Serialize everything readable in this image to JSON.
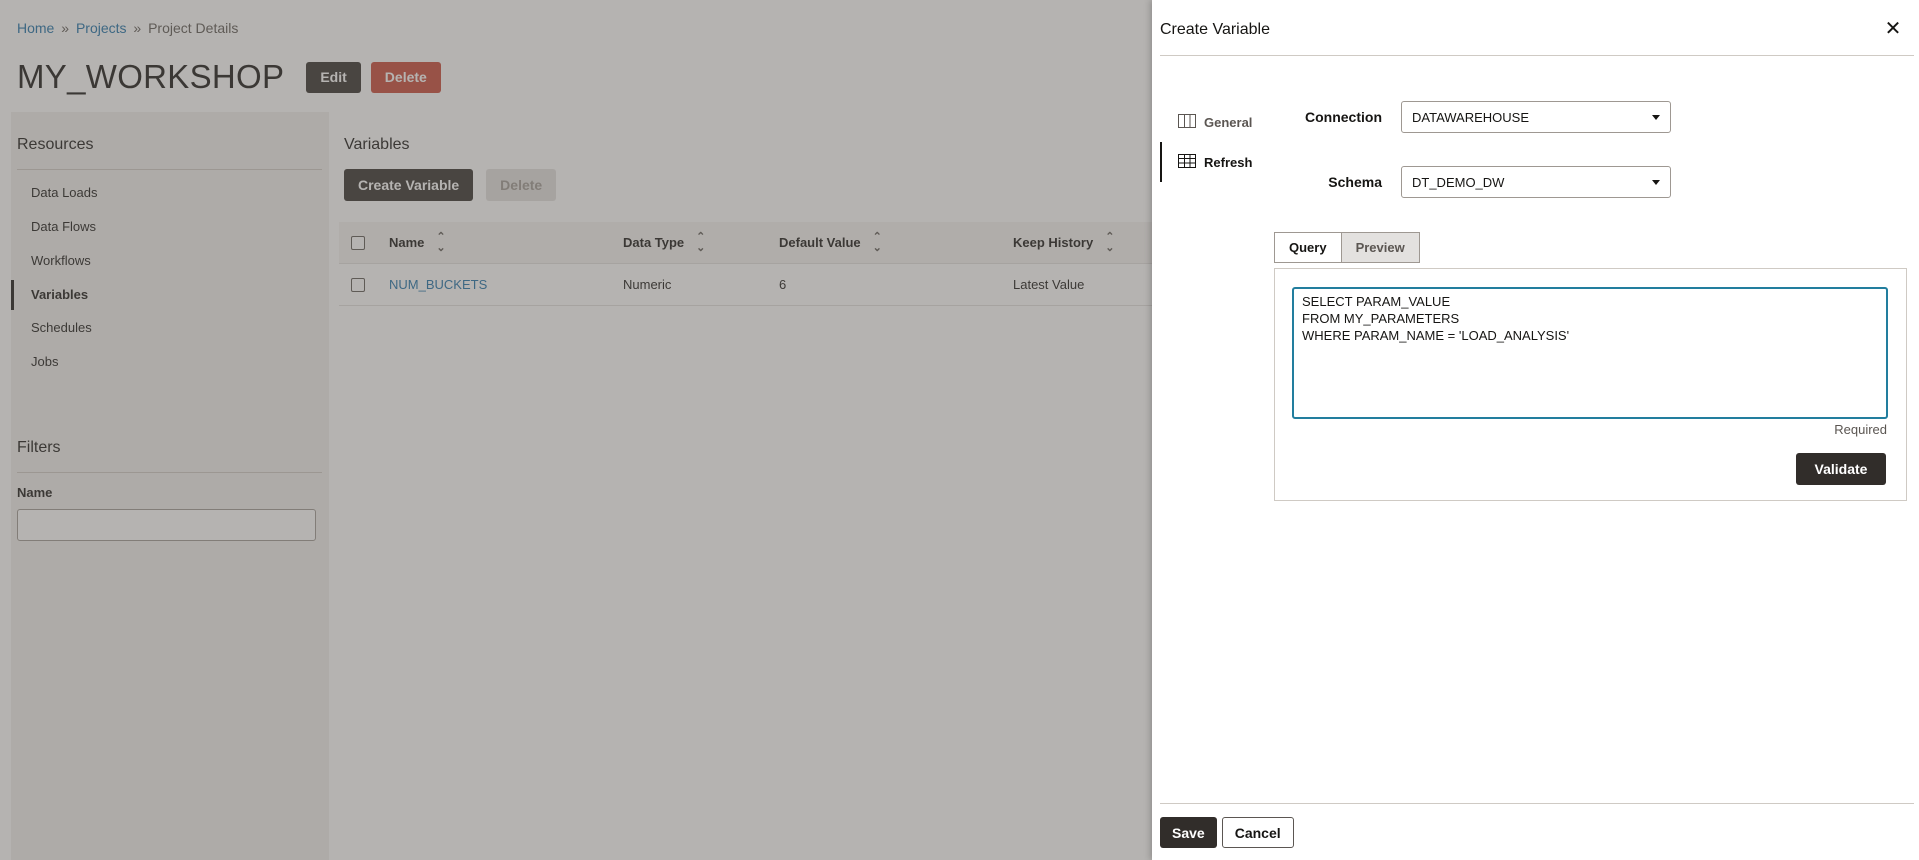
{
  "breadcrumb": {
    "home": "Home",
    "sep": "»",
    "projects": "Projects",
    "current": "Project Details"
  },
  "project": {
    "title": "MY_WORKSHOP",
    "edit_label": "Edit",
    "delete_label": "Delete"
  },
  "sidebar": {
    "resources_heading": "Resources",
    "items": [
      {
        "label": "Data Loads"
      },
      {
        "label": "Data Flows"
      },
      {
        "label": "Workflows"
      },
      {
        "label": "Variables"
      },
      {
        "label": "Schedules"
      },
      {
        "label": "Jobs"
      }
    ],
    "filters_heading": "Filters",
    "name_label": "Name",
    "name_value": ""
  },
  "main": {
    "heading": "Variables",
    "create_label": "Create Variable",
    "delete_label": "Delete",
    "columns": [
      "Name",
      "Data Type",
      "Default Value",
      "Keep History"
    ],
    "rows": [
      {
        "name": "NUM_BUCKETS",
        "data_type": "Numeric",
        "default_value": "6",
        "keep_history": "Latest Value"
      }
    ]
  },
  "drawer": {
    "title": "Create Variable",
    "nav": [
      {
        "label": "General",
        "icon": "columns-icon"
      },
      {
        "label": "Refresh",
        "icon": "table-icon"
      }
    ],
    "connection_label": "Connection",
    "connection_value": "DATAWAREHOUSE",
    "schema_label": "Schema",
    "schema_value": "DT_DEMO_DW",
    "tabs": [
      "Query",
      "Preview"
    ],
    "query_value": "SELECT PARAM_VALUE\nFROM MY_PARAMETERS\nWHERE PARAM_NAME = 'LOAD_ANALYSIS'",
    "required_text": "Required",
    "validate_label": "Validate",
    "save_label": "Save",
    "cancel_label": "Cancel",
    "close_icon": "close-icon"
  },
  "colors": {
    "accent_dark": "#312d2a",
    "danger": "#c74634",
    "link": "#1b6fa8",
    "focus": "#227e9e"
  }
}
